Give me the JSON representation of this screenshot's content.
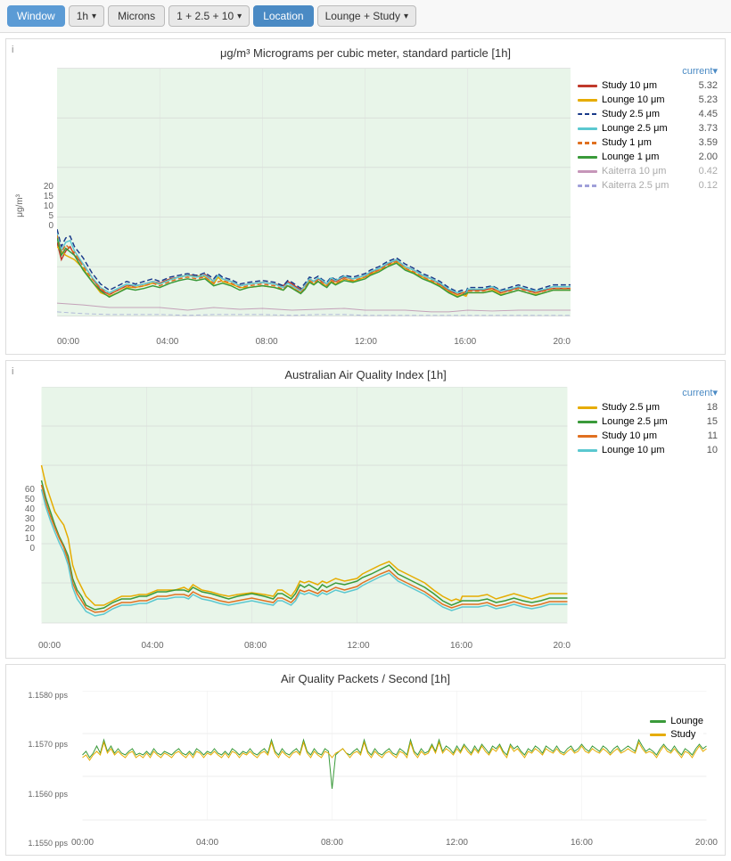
{
  "toolbar": {
    "window_label": "Window",
    "time_label": "1h",
    "time_arrow": "▾",
    "microns_label": "Microns",
    "microns_value": "1 + 2.5 + 10",
    "microns_arrow": "▾",
    "location_label": "Location",
    "location_value": "Lounge + Study",
    "location_arrow": "▾"
  },
  "chart1": {
    "title": "μg/m³ Micrograms per cubic meter, standard particle [1h]",
    "y_label": "μg/m³",
    "y_axis": [
      "20",
      "15",
      "10",
      "5",
      "0"
    ],
    "x_axis": [
      "00:00",
      "04:00",
      "08:00",
      "12:00",
      "16:00",
      "20:0"
    ],
    "legend_header": "current▾",
    "legend": [
      {
        "label": "Study 10 μm",
        "color": "#c0392b",
        "value": "5.32",
        "dim": false,
        "dashed": false
      },
      {
        "label": "Lounge 10 μm",
        "color": "#e6ac00",
        "value": "5.23",
        "dim": false,
        "dashed": false
      },
      {
        "label": "Study 2.5 μm",
        "color": "#1a3a8a",
        "value": "4.45",
        "dim": false,
        "dashed": true
      },
      {
        "label": "Lounge 2.5 μm",
        "color": "#5bc8d0",
        "value": "3.73",
        "dim": false,
        "dashed": false
      },
      {
        "label": "Study 1 μm",
        "color": "#e07020",
        "value": "3.59",
        "dim": false,
        "dashed": true
      },
      {
        "label": "Lounge 1 μm",
        "color": "#3a9a3a",
        "value": "2.00",
        "dim": false,
        "dashed": false
      },
      {
        "label": "Kaiterra 10 μm",
        "color": "#a0508a",
        "value": "0.42",
        "dim": true,
        "dashed": false
      },
      {
        "label": "Kaiterra 2.5 μm",
        "color": "#6060c0",
        "value": "0.12",
        "dim": true,
        "dashed": true
      }
    ]
  },
  "chart2": {
    "title": "Australian Air Quality Index [1h]",
    "y_axis": [
      "60",
      "50",
      "40",
      "30",
      "20",
      "10",
      "0"
    ],
    "x_axis": [
      "00:00",
      "04:00",
      "08:00",
      "12:00",
      "16:00",
      "20:0"
    ],
    "legend_header": "current▾",
    "legend": [
      {
        "label": "Study 2.5 μm",
        "color": "#e6ac00",
        "value": "18",
        "dim": false
      },
      {
        "label": "Lounge 2.5 μm",
        "color": "#3a9a3a",
        "value": "15",
        "dim": false
      },
      {
        "label": "Study 10 μm",
        "color": "#e07020",
        "value": "11",
        "dim": false
      },
      {
        "label": "Lounge 10 μm",
        "color": "#5bc8d0",
        "value": "10",
        "dim": false
      }
    ]
  },
  "chart3": {
    "title": "Air Quality Packets / Second [1h]",
    "y_axis": [
      "1.1580 pps",
      "1.1570 pps",
      "1.1560 pps",
      "1.1550 pps"
    ],
    "x_axis": [
      "00:00",
      "04:00",
      "08:00",
      "12:00",
      "16:00",
      "20:00"
    ],
    "legend": [
      {
        "label": "Lounge",
        "color": "#3a9a3a"
      },
      {
        "label": "Study",
        "color": "#e6ac00"
      }
    ]
  }
}
